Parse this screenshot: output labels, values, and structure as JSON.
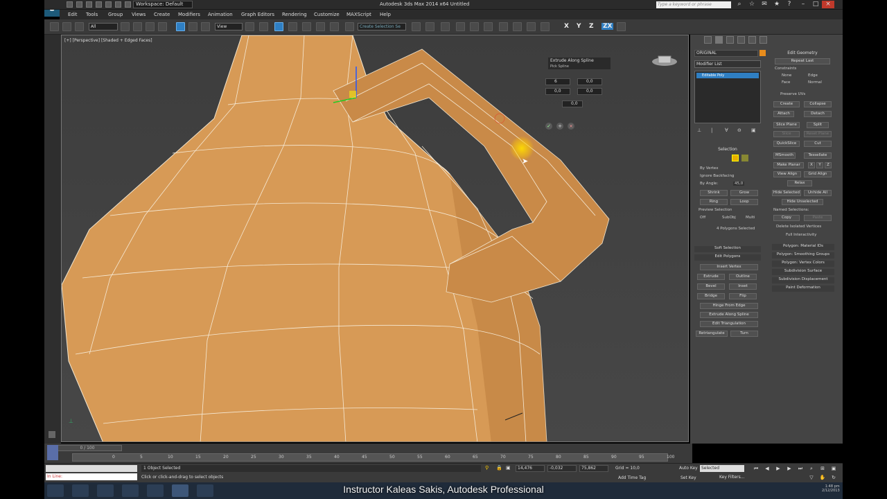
{
  "titlebar": {
    "workspace": "Workspace: Default",
    "app_title": "Autodesk 3ds Max 2014 x64      Untitled",
    "search_placeholder": "Type a keyword or phrase"
  },
  "menu": [
    "Edit",
    "Tools",
    "Group",
    "Views",
    "Create",
    "Modifiers",
    "Animation",
    "Graph Editors",
    "Rendering",
    "Customize",
    "MAXScript",
    "Help"
  ],
  "toolbar": {
    "filter_value": "All",
    "refcoord_value": "View",
    "selection_set": "Create Selection Se",
    "axes": [
      "X",
      "Y",
      "Z",
      "ZX"
    ],
    "axis_active": "ZX"
  },
  "viewport": {
    "label": "[+] [Perspective] [Shaded + Edged Faces]",
    "caddy": {
      "title": "Extrude Along Spline",
      "pick": "Pick Spline",
      "segments": "6",
      "taper_amount": "0,0",
      "taper_curve": "0,0",
      "twist": "0,0",
      "extra": "0,0"
    }
  },
  "command_panel": {
    "object_name": "ORIGINAL",
    "modifier_list": "Modifier List",
    "stack_item": "Editable Poly",
    "selection": {
      "title": "Selection",
      "by_vertex": "By Vertex",
      "ignore_backfacing": "Ignore Backfacing",
      "by_angle": "By Angle:",
      "angle_value": "45,0",
      "shrink": "Shrink",
      "grow": "Grow",
      "ring": "Ring",
      "loop": "Loop",
      "preview_title": "Preview Selection",
      "off": "Off",
      "subobj": "SubObj",
      "multi": "Multi",
      "status": "4 Polygons Selected"
    },
    "soft_selection": "Soft Selection",
    "edit_polygons": {
      "title": "Edit Polygons",
      "insert_vertex": "Insert Vertex",
      "extrude": "Extrude",
      "outline": "Outline",
      "bevel": "Bevel",
      "inset": "Inset",
      "bridge": "Bridge",
      "flip": "Flip",
      "hinge": "Hinge From Edge",
      "extrude_spline": "Extrude Along Spline",
      "edit_tri": "Edit Triangulation",
      "retriangulate": "Retriangulate",
      "turn": "Turn"
    },
    "edit_geometry": {
      "title": "Edit Geometry",
      "repeat_last": "Repeat Last",
      "constraints": "Constraints",
      "none": "None",
      "edge": "Edge",
      "face": "Face",
      "normal": "Normal",
      "preserve_uvs": "Preserve UVs",
      "create": "Create",
      "collapse": "Collapse",
      "attach": "Attach",
      "detach": "Detach",
      "slice_plane": "Slice Plane",
      "split": "Split",
      "slice": "Slice",
      "reset_plane": "Reset Plane",
      "quickslice": "QuickSlice",
      "cut": "Cut",
      "msmooth": "MSmooth",
      "tessellate": "Tessellate",
      "make_planar": "Make Planar",
      "x": "X",
      "y": "Y",
      "z": "Z",
      "view_align": "View Align",
      "grid_align": "Grid Align",
      "relax": "Relax",
      "hide_selected": "Hide Selected",
      "unhide_all": "Unhide All",
      "hide_unselected": "Hide Unselected",
      "named_selections": "Named Selections:",
      "copy": "Copy",
      "paste": "Paste",
      "delete_isolated": "Delete Isolated Vertices",
      "full_interactivity": "Full Interactivity"
    },
    "rollouts": [
      "Polygon: Material IDs",
      "Polygon: Smoothing Groups",
      "Polygon: Vertex Colors",
      "Subdivision Surface",
      "Subdivision Displacement",
      "Paint Deformation"
    ]
  },
  "timeline": {
    "slider": "0 / 100",
    "ticks": [
      "0",
      "5",
      "10",
      "15",
      "20",
      "25",
      "30",
      "35",
      "40",
      "45",
      "50",
      "55",
      "60",
      "65",
      "70",
      "75",
      "80",
      "85",
      "90",
      "95",
      "100"
    ]
  },
  "status": {
    "maxscript": "In Line:",
    "selection": "1 Object Selected",
    "prompt": "Click or click-and-drag to select objects",
    "x": "14,476",
    "y": "-0,032",
    "z": "75,862",
    "grid": "Grid = 10,0",
    "add_time_tag": "Add Time Tag",
    "auto_key": "Auto Key",
    "set_key": "Set Key",
    "key_mode": "Selected",
    "key_filters": "Key Filters...",
    "tray_time": "1:48 pm",
    "tray_date": "2/12/2013"
  },
  "caption": "Instructor Kaleas Sakis, Autodesk Professional",
  "colors": {
    "mesh": "#d69a56",
    "accent": "#2f7fc3",
    "highlight": "#ffd000"
  }
}
